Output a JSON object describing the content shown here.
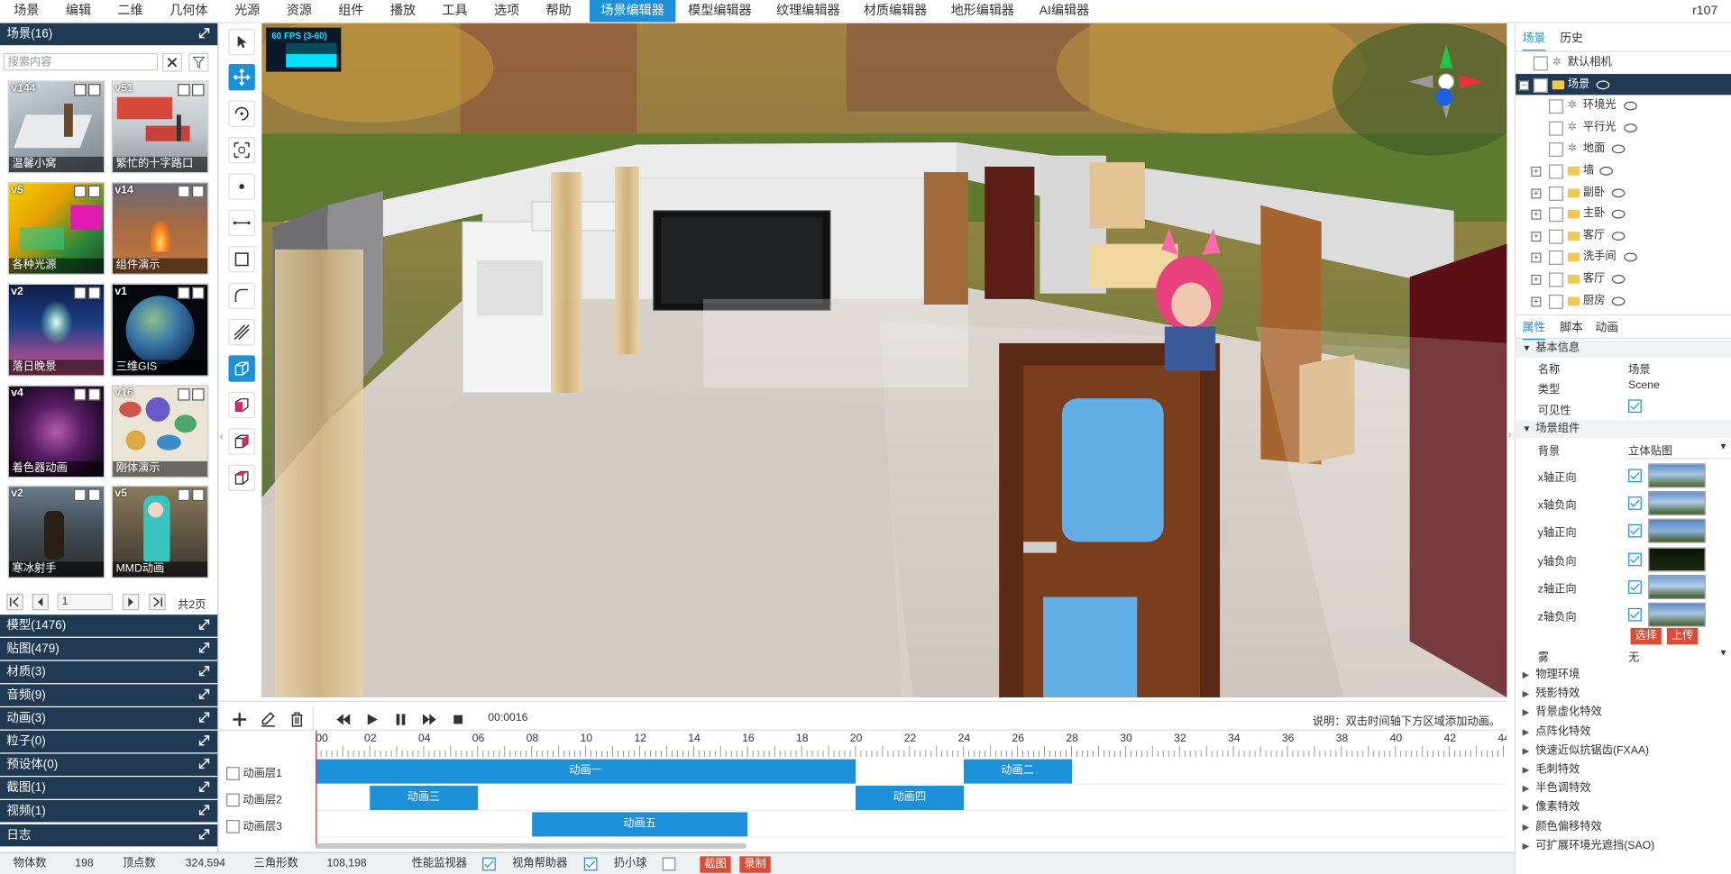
{
  "menubar": {
    "items": [
      "场景",
      "编辑",
      "二维",
      "几何体",
      "光源",
      "资源",
      "组件",
      "播放",
      "工具",
      "选项",
      "帮助",
      "场景编辑器",
      "模型编辑器",
      "纹理编辑器",
      "材质编辑器",
      "地形编辑器",
      "AI编辑器"
    ],
    "active": "场景编辑器",
    "version": "r107"
  },
  "left": {
    "scene_header": "场景(16)",
    "search_placeholder": "搜索内容",
    "scenes": [
      {
        "version": "v144",
        "name": "温馨小窝"
      },
      {
        "version": "v51",
        "name": "繁忙的十字路口"
      },
      {
        "version": "v5",
        "name": "各种光源"
      },
      {
        "version": "v14",
        "name": "组件演示"
      },
      {
        "version": "v2",
        "name": "落日晚景"
      },
      {
        "version": "v1",
        "name": "三维GIS"
      },
      {
        "version": "v4",
        "name": "着色器动画"
      },
      {
        "version": "v16",
        "name": "刚体演示"
      },
      {
        "version": "v2",
        "name": "寒冰射手"
      },
      {
        "version": "v5",
        "name": "MMD动画"
      }
    ],
    "pager": {
      "page": "1",
      "total": "共2页"
    },
    "categories": [
      "模型(1476)",
      "贴图(479)",
      "材质(3)",
      "音频(9)",
      "动画(3)",
      "粒子(0)",
      "预设体(0)",
      "截图(1)",
      "视频(1)",
      "日志"
    ]
  },
  "viewport": {
    "fps": "60 FPS (3-60)"
  },
  "timeline": {
    "time": "00:0016",
    "hint": "说明：双击时间轴下方区域添加动画。",
    "ticks": [
      "00",
      "02",
      "04",
      "06",
      "08",
      "10",
      "12",
      "14",
      "16",
      "18",
      "20",
      "22",
      "24",
      "26",
      "28",
      "30",
      "32",
      "34",
      "36",
      "38",
      "40",
      "42",
      "44"
    ],
    "layers": [
      {
        "name": "动画层1",
        "clips": [
          {
            "label": "动画一",
            "start": 0,
            "end": 20
          },
          {
            "label": "动画二",
            "start": 24,
            "end": 28
          }
        ]
      },
      {
        "name": "动画层2",
        "clips": [
          {
            "label": "动画三",
            "start": 2,
            "end": 6
          },
          {
            "label": "动画四",
            "start": 20,
            "end": 24
          }
        ]
      },
      {
        "name": "动画层3",
        "clips": [
          {
            "label": "动画五",
            "start": 8,
            "end": 16
          }
        ]
      }
    ]
  },
  "right": {
    "top_tabs": [
      "场景",
      "历史"
    ],
    "tree": [
      {
        "label": "默认相机",
        "kind": "camera",
        "depth": 0
      },
      {
        "label": "场景",
        "kind": "folder",
        "depth": 0,
        "selected": true
      },
      {
        "label": "环境光",
        "kind": "light",
        "depth": 1
      },
      {
        "label": "平行光",
        "kind": "light",
        "depth": 1
      },
      {
        "label": "地面",
        "kind": "light",
        "depth": 1
      },
      {
        "label": "墙",
        "kind": "folder",
        "depth": 1
      },
      {
        "label": "副卧",
        "kind": "folder",
        "depth": 1
      },
      {
        "label": "主卧",
        "kind": "folder",
        "depth": 1
      },
      {
        "label": "客厅",
        "kind": "folder",
        "depth": 1
      },
      {
        "label": "洗手间",
        "kind": "folder",
        "depth": 1
      },
      {
        "label": "客厅",
        "kind": "folder",
        "depth": 1
      },
      {
        "label": "厨房",
        "kind": "folder",
        "depth": 1
      }
    ],
    "prop_tabs": [
      "属性",
      "脚本",
      "动画"
    ],
    "basic_header": "基本信息",
    "basic": {
      "name_label": "名称",
      "name_value": "场景",
      "type_label": "类型",
      "type_value": "Scene",
      "visible_label": "可见性"
    },
    "component_header": "场景组件",
    "background_label": "背景",
    "background_value": "立体贴图",
    "cube_faces": [
      "x轴正向",
      "x轴负向",
      "y轴正向",
      "y轴负向",
      "z轴正向",
      "z轴负向"
    ],
    "select_btn": "选择",
    "upload_btn": "上传",
    "fog_label": "雾",
    "fog_value": "无",
    "effects": [
      "物理环境",
      "残影特效",
      "背景虚化特效",
      "点阵化特效",
      "快速近似抗锯齿(FXAA)",
      "毛刺特效",
      "半色调特效",
      "像素特效",
      "颜色偏移特效",
      "可扩展环境光遮挡(SAO)"
    ]
  },
  "status": {
    "objects_label": "物体数",
    "objects": "198",
    "vertices_label": "顶点数",
    "vertices": "324,594",
    "triangles_label": "三角形数",
    "triangles": "108,198",
    "perf_label": "性能监视器",
    "helper_label": "视角帮助器",
    "ball_label": "扔小球",
    "screenshot_btn": "截图",
    "record_btn": "录制"
  },
  "colors": {
    "accent": "#1c90d8",
    "dark": "#1f3a52",
    "red": "#e04a33"
  }
}
